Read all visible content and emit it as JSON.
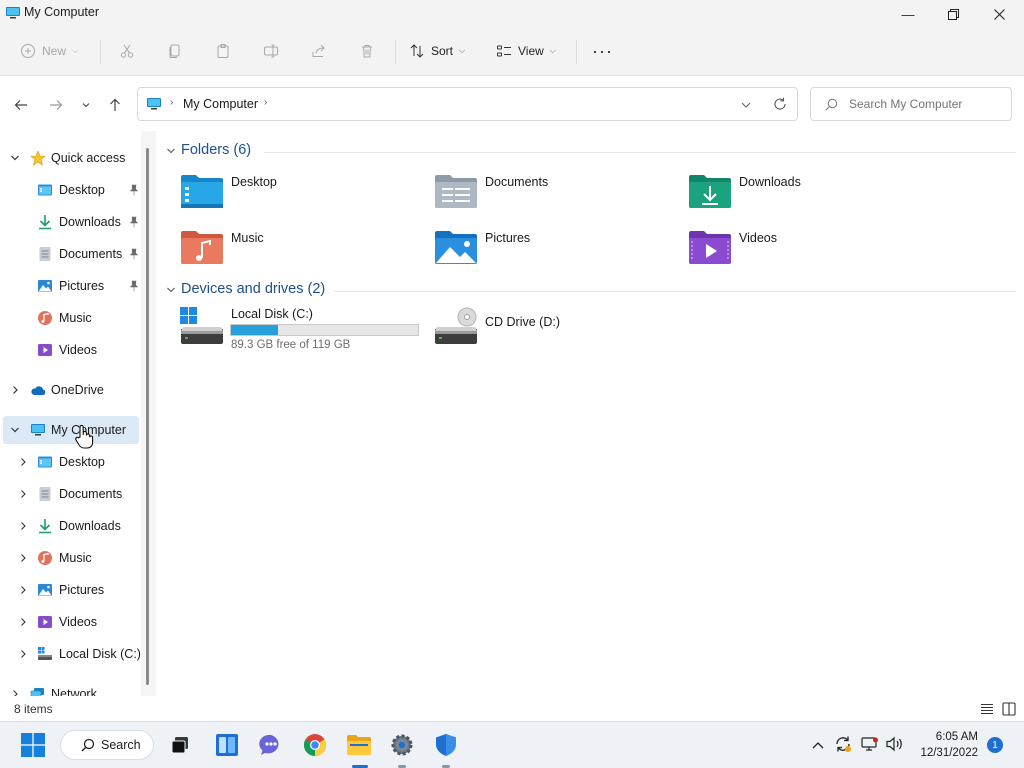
{
  "window": {
    "title": "My Computer",
    "minimize_icon": "minimize-icon",
    "maximize_icon": "restore-icon",
    "close_icon": "close-icon"
  },
  "toolbar": {
    "new_label": "New",
    "sort_label": "Sort",
    "view_label": "View",
    "more_icon": "more-icon",
    "disabled_icons": [
      "cut-icon",
      "copy-icon",
      "paste-icon",
      "rename-icon",
      "share-icon",
      "delete-icon"
    ]
  },
  "address": {
    "path": [
      "My Computer"
    ],
    "search_placeholder": "Search My Computer"
  },
  "nav": {
    "quick_access": "Quick access",
    "quick_items": [
      {
        "label": "Desktop",
        "pinned": true
      },
      {
        "label": "Downloads",
        "pinned": true
      },
      {
        "label": "Documents",
        "pinned": true
      },
      {
        "label": "Pictures",
        "pinned": true
      },
      {
        "label": "Music",
        "pinned": false
      },
      {
        "label": "Videos",
        "pinned": false
      }
    ],
    "onedrive": "OneDrive",
    "my_computer": "My Computer",
    "computer_items": [
      "Desktop",
      "Documents",
      "Downloads",
      "Music",
      "Pictures",
      "Videos",
      "Local Disk (C:)"
    ],
    "network": "Network"
  },
  "content": {
    "folders_header": "Folders (6)",
    "folders": [
      "Desktop",
      "Documents",
      "Downloads",
      "Music",
      "Pictures",
      "Videos"
    ],
    "devices_header": "Devices and drives (2)",
    "drives": [
      {
        "name": "Local Disk (C:)",
        "free_text": "89.3 GB free of 119 GB",
        "used_fraction": 0.25
      },
      {
        "name": "CD Drive (D:)"
      }
    ]
  },
  "status": {
    "item_count": "8 items"
  },
  "taskbar": {
    "search_label": "Search",
    "time": "6:05 AM",
    "date": "12/31/2022",
    "notification_count": "1"
  },
  "colors": {
    "accent": "#26a0da",
    "selection": "#dbe9f6",
    "section_header": "#1d4f8f"
  }
}
